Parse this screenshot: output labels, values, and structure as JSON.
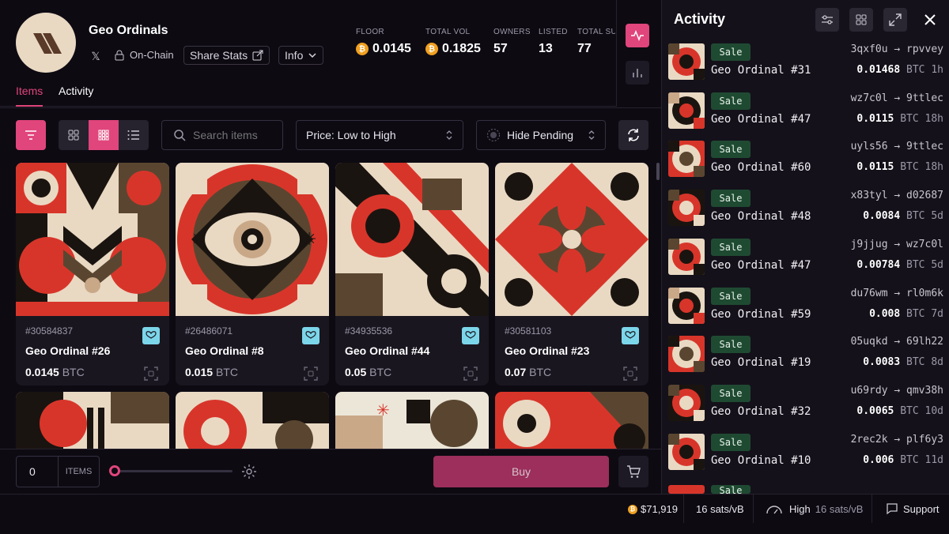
{
  "collection": {
    "name": "Geo Ordinals",
    "onchain_label": "On-Chain",
    "share_label": "Share Stats",
    "info_label": "Info"
  },
  "stats": [
    {
      "label": "FLOOR",
      "value": "0.0145",
      "coin": true
    },
    {
      "label": "TOTAL VOL",
      "value": "0.1825",
      "coin": true
    },
    {
      "label": "OWNERS",
      "value": "57",
      "coin": false
    },
    {
      "label": "LISTED",
      "value": "13",
      "coin": false
    },
    {
      "label": "TOTAL SUP",
      "value": "77",
      "coin": false
    }
  ],
  "tabs": {
    "items": "Items",
    "activity": "Activity"
  },
  "toolbar": {
    "search_placeholder": "Search items",
    "sort_label": "Price: Low to High",
    "pending_label": "Hide Pending"
  },
  "cards": [
    {
      "number": "#30584837",
      "name": "Geo Ordinal #26",
      "price": "0.0145",
      "unit": "BTC"
    },
    {
      "number": "#26486071",
      "name": "Geo Ordinal #8",
      "price": "0.015",
      "unit": "BTC"
    },
    {
      "number": "#34935536",
      "name": "Geo Ordinal #44",
      "price": "0.05",
      "unit": "BTC"
    },
    {
      "number": "#30581103",
      "name": "Geo Ordinal #23",
      "price": "0.07",
      "unit": "BTC"
    }
  ],
  "bottom": {
    "count": "0",
    "items_label": "ITEMS",
    "buy_label": "Buy"
  },
  "status": {
    "btc_price": "$71,919",
    "fee": "16 sats/vB",
    "priority": "High",
    "priority_fee": "16 sats/vB",
    "support": "Support"
  },
  "activity": {
    "title": "Activity",
    "rows": [
      {
        "type": "Sale",
        "name": "Geo Ordinal #31",
        "from": "3qxf0u",
        "to": "rpvvey",
        "price": "0.01468",
        "unit": "BTC",
        "age": "1h"
      },
      {
        "type": "Sale",
        "name": "Geo Ordinal #47",
        "from": "wz7c0l",
        "to": "9ttlec",
        "price": "0.0115",
        "unit": "BTC",
        "age": "18h"
      },
      {
        "type": "Sale",
        "name": "Geo Ordinal #60",
        "from": "uyls56",
        "to": "9ttlec",
        "price": "0.0115",
        "unit": "BTC",
        "age": "18h"
      },
      {
        "type": "Sale",
        "name": "Geo Ordinal #48",
        "from": "x83tyl",
        "to": "d02687",
        "price": "0.0084",
        "unit": "BTC",
        "age": "5d"
      },
      {
        "type": "Sale",
        "name": "Geo Ordinal #47",
        "from": "j9jjug",
        "to": "wz7c0l",
        "price": "0.00784",
        "unit": "BTC",
        "age": "5d"
      },
      {
        "type": "Sale",
        "name": "Geo Ordinal #59",
        "from": "du76wm",
        "to": "rl0m6k",
        "price": "0.008",
        "unit": "BTC",
        "age": "7d"
      },
      {
        "type": "Sale",
        "name": "Geo Ordinal #19",
        "from": "05uqkd",
        "to": "69lh22",
        "price": "0.0083",
        "unit": "BTC",
        "age": "8d"
      },
      {
        "type": "Sale",
        "name": "Geo Ordinal #32",
        "from": "u69rdy",
        "to": "qmv38h",
        "price": "0.0065",
        "unit": "BTC",
        "age": "10d"
      },
      {
        "type": "Sale",
        "name": "Geo Ordinal #10",
        "from": "2rec2k",
        "to": "plf6y3",
        "price": "0.006",
        "unit": "BTC",
        "age": "11d"
      }
    ]
  },
  "colors": {
    "accent": "#e0457b",
    "sale_bg": "#1f4a32",
    "art_red": "#d8352a",
    "art_cream": "#e9d9c3",
    "art_brown": "#5a4630"
  }
}
